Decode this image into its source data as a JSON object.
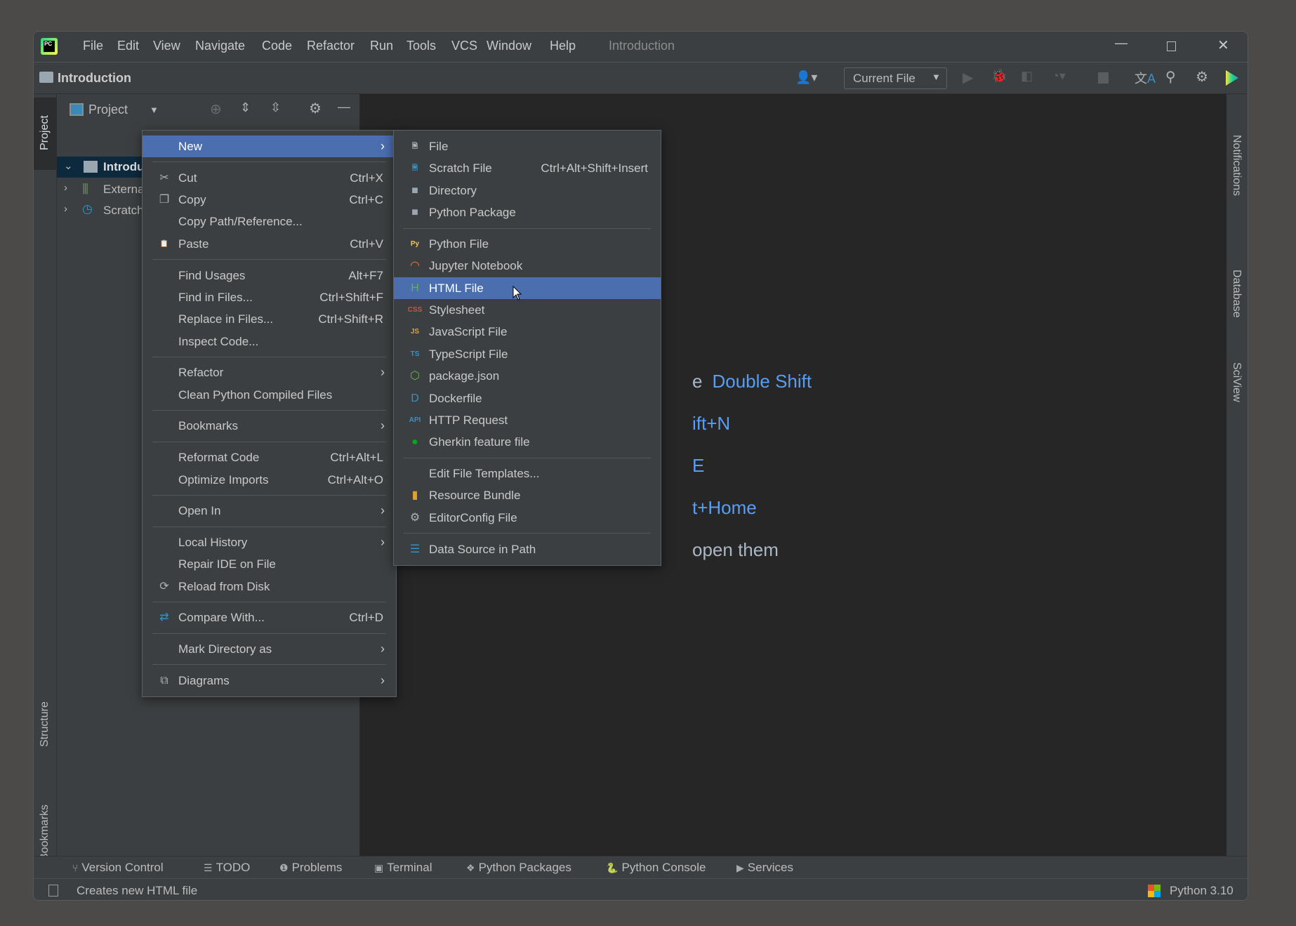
{
  "window": {
    "title": "Introduction",
    "controls": [
      "minimize",
      "maximize",
      "close"
    ]
  },
  "menubar": [
    "File",
    "Edit",
    "View",
    "Navigate",
    "Code",
    "Refactor",
    "Run",
    "Tools",
    "VCS",
    "Window",
    "Help"
  ],
  "navbar": {
    "breadcrumb": "Introduction",
    "run_config": "Current File"
  },
  "project_panel": {
    "title": "Project",
    "tree": [
      {
        "label": "Introduction",
        "selected": true,
        "expanded": true
      },
      {
        "label": "External Libraries"
      },
      {
        "label": "Scratches and Consoles"
      }
    ]
  },
  "left_stripe": [
    "Project",
    "Structure",
    "Bookmarks"
  ],
  "right_stripe": [
    "Notifications",
    "Database",
    "SciView"
  ],
  "editor_hints": [
    {
      "grey": "e",
      "blue": "Double Shift"
    },
    {
      "blue": "ift+N"
    },
    {
      "blue": "E"
    },
    {
      "blue": "t+Home"
    },
    {
      "grey": "open them"
    }
  ],
  "context_menu": [
    {
      "label": "New",
      "submenu": true,
      "selected": true
    },
    {
      "sep": true
    },
    {
      "label": "Cut",
      "shortcut": "Ctrl+X",
      "icon": "scissors-icon"
    },
    {
      "label": "Copy",
      "shortcut": "Ctrl+C",
      "icon": "copy-icon"
    },
    {
      "label": "Copy Path/Reference..."
    },
    {
      "label": "Paste",
      "shortcut": "Ctrl+V",
      "icon": "clipboard-icon"
    },
    {
      "sep": true
    },
    {
      "label": "Find Usages",
      "shortcut": "Alt+F7"
    },
    {
      "label": "Find in Files...",
      "shortcut": "Ctrl+Shift+F"
    },
    {
      "label": "Replace in Files...",
      "shortcut": "Ctrl+Shift+R"
    },
    {
      "label": "Inspect Code..."
    },
    {
      "sep": true
    },
    {
      "label": "Refactor",
      "submenu": true
    },
    {
      "label": "Clean Python Compiled Files"
    },
    {
      "sep": true
    },
    {
      "label": "Bookmarks",
      "submenu": true
    },
    {
      "sep": true
    },
    {
      "label": "Reformat Code",
      "shortcut": "Ctrl+Alt+L"
    },
    {
      "label": "Optimize Imports",
      "shortcut": "Ctrl+Alt+O"
    },
    {
      "sep": true
    },
    {
      "label": "Open In",
      "submenu": true
    },
    {
      "sep": true
    },
    {
      "label": "Local History",
      "submenu": true
    },
    {
      "label": "Repair IDE on File"
    },
    {
      "label": "Reload from Disk",
      "icon": "reload-icon"
    },
    {
      "sep": true
    },
    {
      "label": "Compare With...",
      "shortcut": "Ctrl+D",
      "icon": "compare-icon"
    },
    {
      "sep": true
    },
    {
      "label": "Mark Directory as",
      "submenu": true
    },
    {
      "sep": true
    },
    {
      "label": "Diagrams",
      "submenu": true,
      "icon": "diagram-icon"
    }
  ],
  "new_submenu": [
    {
      "label": "File",
      "icon": "file-icon"
    },
    {
      "label": "Scratch File",
      "shortcut": "Ctrl+Alt+Shift+Insert",
      "icon": "scratch-file-icon"
    },
    {
      "label": "Directory",
      "icon": "folder-icon"
    },
    {
      "label": "Python Package",
      "icon": "package-folder-icon"
    },
    {
      "sep": true
    },
    {
      "label": "Python File",
      "icon": "python-file-icon"
    },
    {
      "label": "Jupyter Notebook",
      "icon": "jupyter-icon"
    },
    {
      "label": "HTML File",
      "icon": "html-file-icon",
      "selected": true
    },
    {
      "label": "Stylesheet",
      "icon": "css-file-icon"
    },
    {
      "label": "JavaScript File",
      "icon": "js-file-icon"
    },
    {
      "label": "TypeScript File",
      "icon": "ts-file-icon"
    },
    {
      "label": "package.json",
      "icon": "nodejs-icon"
    },
    {
      "label": "Dockerfile",
      "icon": "docker-file-icon"
    },
    {
      "label": "HTTP Request",
      "icon": "api-file-icon"
    },
    {
      "label": "Gherkin feature file",
      "icon": "cucumber-icon"
    },
    {
      "sep": true
    },
    {
      "label": "Edit File Templates..."
    },
    {
      "label": "Resource Bundle",
      "icon": "resource-bundle-icon"
    },
    {
      "label": "EditorConfig File",
      "icon": "gear-icon"
    },
    {
      "sep": true
    },
    {
      "label": "Data Source in Path",
      "icon": "database-icon"
    }
  ],
  "tool_windows": [
    "Version Control",
    "TODO",
    "Problems",
    "Terminal",
    "Python Packages",
    "Python Console",
    "Services"
  ],
  "status": {
    "message": "Creates new HTML file",
    "interpreter": "Python 3.10"
  },
  "colors": {
    "accent": "#4b6eaf",
    "link": "#589df6",
    "selection_tree": "#0d293e",
    "editor_bg": "#262626"
  }
}
